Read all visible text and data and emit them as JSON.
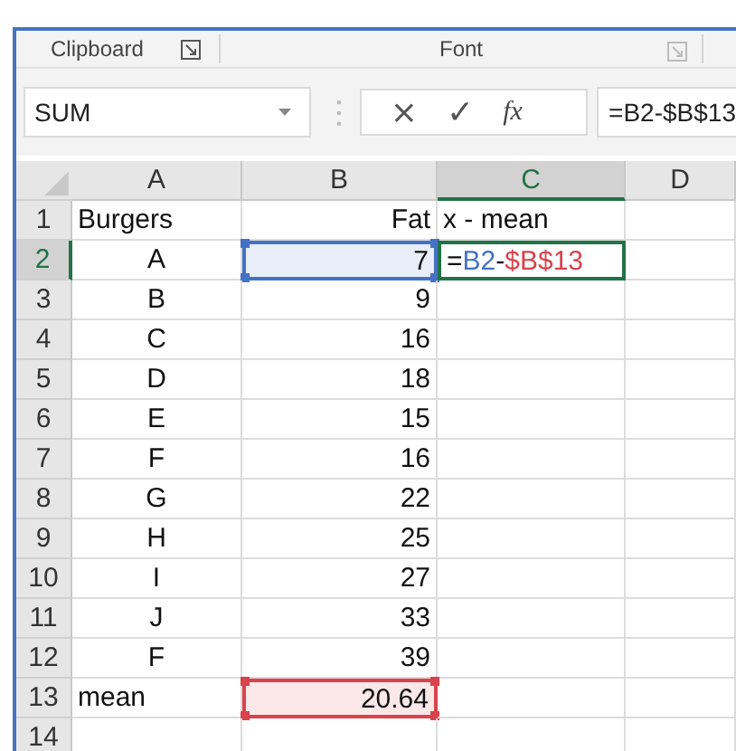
{
  "ribbon_groups": [
    {
      "label": "Clipboard",
      "launcher_enabled": true
    },
    {
      "label": "Font",
      "launcher_enabled": false
    }
  ],
  "formula_bar": {
    "name_box": "SUM",
    "cancel": "×",
    "enter": "✓",
    "function": "fx",
    "formula": "=B2-$B$13"
  },
  "columns": [
    {
      "label": "A",
      "selected": false
    },
    {
      "label": "B",
      "selected": false
    },
    {
      "label": "C",
      "selected": true
    },
    {
      "label": "D",
      "selected": false
    }
  ],
  "rows": [
    {
      "label": "1",
      "selected": false,
      "cells": [
        {
          "kind": "text",
          "text": "Burgers"
        },
        {
          "kind": "number",
          "text": "Fat"
        },
        {
          "kind": "text",
          "text": "x - mean"
        },
        {
          "kind": "empty"
        }
      ]
    },
    {
      "label": "2",
      "selected": true,
      "cells": [
        {
          "kind": "centered",
          "text": "A"
        },
        {
          "kind": "number",
          "text": "7",
          "color": "#4472c4"
        },
        {
          "kind": "formula",
          "active": true,
          "parts": [
            {
              "kind": "plain",
              "text": "="
            },
            {
              "kind": "ref",
              "text": "B2",
              "color": "#4472c4"
            },
            {
              "kind": "plain",
              "text": "-"
            },
            {
              "kind": "ref",
              "text": "$B$13",
              "color": "#d9434b"
            }
          ]
        },
        {
          "kind": "empty"
        }
      ]
    },
    {
      "label": "3",
      "selected": false,
      "cells": [
        {
          "kind": "centered",
          "text": "B"
        },
        {
          "kind": "number",
          "text": "9"
        },
        {
          "kind": "empty"
        },
        {
          "kind": "empty"
        }
      ]
    },
    {
      "label": "4",
      "selected": false,
      "cells": [
        {
          "kind": "centered",
          "text": "C"
        },
        {
          "kind": "number",
          "text": "16"
        },
        {
          "kind": "empty"
        },
        {
          "kind": "empty"
        }
      ]
    },
    {
      "label": "5",
      "selected": false,
      "cells": [
        {
          "kind": "centered",
          "text": "D"
        },
        {
          "kind": "number",
          "text": "18"
        },
        {
          "kind": "empty"
        },
        {
          "kind": "empty"
        }
      ]
    },
    {
      "label": "6",
      "selected": false,
      "cells": [
        {
          "kind": "centered",
          "text": "E"
        },
        {
          "kind": "number",
          "text": "15"
        },
        {
          "kind": "empty"
        },
        {
          "kind": "empty"
        }
      ]
    },
    {
      "label": "7",
      "selected": false,
      "cells": [
        {
          "kind": "centered",
          "text": "F"
        },
        {
          "kind": "number",
          "text": "16"
        },
        {
          "kind": "empty"
        },
        {
          "kind": "empty"
        }
      ]
    },
    {
      "label": "8",
      "selected": false,
      "cells": [
        {
          "kind": "centered",
          "text": "G"
        },
        {
          "kind": "number",
          "text": "22"
        },
        {
          "kind": "empty"
        },
        {
          "kind": "empty"
        }
      ]
    },
    {
      "label": "9",
      "selected": false,
      "cells": [
        {
          "kind": "centered",
          "text": "H"
        },
        {
          "kind": "number",
          "text": "25"
        },
        {
          "kind": "empty"
        },
        {
          "kind": "empty"
        }
      ]
    },
    {
      "label": "10",
      "selected": false,
      "cells": [
        {
          "kind": "centered",
          "text": "I"
        },
        {
          "kind": "number",
          "text": "27"
        },
        {
          "kind": "empty"
        },
        {
          "kind": "empty"
        }
      ]
    },
    {
      "label": "11",
      "selected": false,
      "cells": [
        {
          "kind": "centered",
          "text": "J"
        },
        {
          "kind": "number",
          "text": "33"
        },
        {
          "kind": "empty"
        },
        {
          "kind": "empty"
        }
      ]
    },
    {
      "label": "12",
      "selected": false,
      "cells": [
        {
          "kind": "centered",
          "text": "F"
        },
        {
          "kind": "number",
          "text": "39"
        },
        {
          "kind": "empty"
        },
        {
          "kind": "empty"
        }
      ]
    },
    {
      "label": "13",
      "selected": false,
      "cells": [
        {
          "kind": "text",
          "text": "mean"
        },
        {
          "kind": "number",
          "text": "20.64",
          "color": "#d9434b"
        },
        {
          "kind": "empty"
        },
        {
          "kind": "empty"
        }
      ]
    },
    {
      "label": "14",
      "selected": false,
      "cells": [
        {
          "kind": "empty"
        },
        {
          "kind": "empty"
        },
        {
          "kind": "empty"
        },
        {
          "kind": "empty"
        }
      ]
    }
  ]
}
